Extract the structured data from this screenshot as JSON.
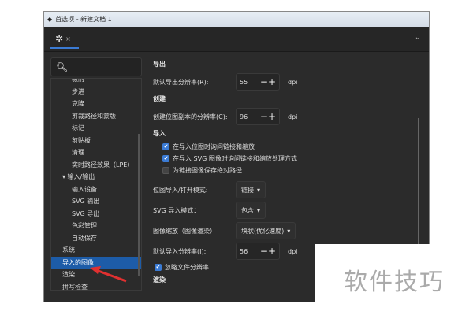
{
  "window": {
    "title": "首选项 - 新建文档 1"
  },
  "tab": {
    "close": "×"
  },
  "sidebar": {
    "items": [
      {
        "label": "吸附",
        "level": 2
      },
      {
        "label": "步进",
        "level": 2
      },
      {
        "label": "克隆",
        "level": 2
      },
      {
        "label": "剪裁路径和蒙版",
        "level": 2
      },
      {
        "label": "标记",
        "level": 2
      },
      {
        "label": "剪贴板",
        "level": 2
      },
      {
        "label": "清理",
        "level": 2
      },
      {
        "label": "实时路径效果（LPE）",
        "level": 2
      },
      {
        "label": "▾ 输入/输出",
        "level": 1
      },
      {
        "label": "输入设备",
        "level": 2
      },
      {
        "label": "SVG 输出",
        "level": 2
      },
      {
        "label": "SVG 导出",
        "level": 2
      },
      {
        "label": "色彩管理",
        "level": 2
      },
      {
        "label": "自动保存",
        "level": 2
      },
      {
        "label": "系统",
        "level": 1
      },
      {
        "label": "导入的图像",
        "level": 1,
        "selected": true
      },
      {
        "label": "渲染",
        "level": 1
      },
      {
        "label": "拼写检查",
        "level": 1
      }
    ]
  },
  "content": {
    "export_heading": "导出",
    "export_res_label": "默认导出分辨率(R):",
    "export_res": "55",
    "create_heading": "创建",
    "create_res_label": "创建位图副本的分辨率(C):",
    "create_res": "96",
    "import_heading": "导入",
    "chk1": "在导入位图时询问链接和缩放",
    "chk2": "在导入 SVG 图像时询问链接和缩放处理方式",
    "chk3": "为链接图像保存绝对路径",
    "bitmap_mode_label": "位图导入/打开模式:",
    "bitmap_mode": "链接",
    "svg_mode_label": "SVG 导入模式：",
    "svg_mode": "包含",
    "scale_label": "图像缩放（图像渲染）",
    "scale": "块状(优化速度)",
    "import_res_label": "默认导入分辨率(I):",
    "import_res": "56",
    "ignore_label": "忽略文件分辨率",
    "render_heading": "渲染",
    "unit": "dpi",
    "minus": "−",
    "plus": "+"
  },
  "watermark": "软件技巧"
}
